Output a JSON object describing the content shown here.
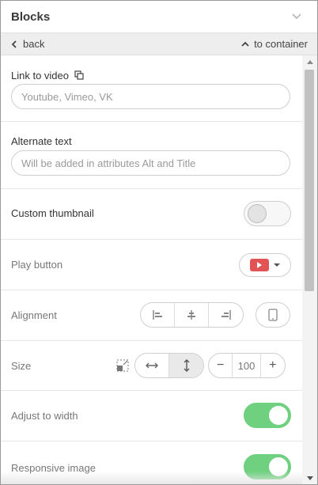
{
  "header": {
    "title": "Blocks",
    "collapse_icon": "chevron-down-icon"
  },
  "nav": {
    "back_label": "back",
    "container_label": "to container"
  },
  "fields": {
    "video_link": {
      "label": "Link to video",
      "placeholder": "Youtube, Vimeo, VK",
      "value": ""
    },
    "alt_text": {
      "label": "Alternate text",
      "placeholder": "Will be added in attributes Alt and Title",
      "value": ""
    }
  },
  "settings": {
    "custom_thumbnail": {
      "label": "Custom thumbnail",
      "enabled": false
    },
    "play_button": {
      "label": "Play button",
      "selected_icon": "youtube-play-icon"
    },
    "alignment": {
      "label": "Alignment",
      "options": [
        "align-left-icon",
        "align-center-icon",
        "align-right-icon"
      ],
      "device_icon": "mobile-icon"
    },
    "size": {
      "label": "Size",
      "mode_icons": [
        "fit-width-icon",
        "fit-height-icon"
      ],
      "active_mode": "fit-height",
      "value": "100",
      "decrement": "−",
      "increment": "+"
    },
    "adjust_to_width": {
      "label": "Adjust to width",
      "enabled": true
    },
    "responsive_image": {
      "label": "Responsive image",
      "enabled": true
    }
  },
  "colors": {
    "toggle_on": "#6fd07f",
    "youtube_red": "#e25454",
    "border": "#cfcfcf"
  }
}
